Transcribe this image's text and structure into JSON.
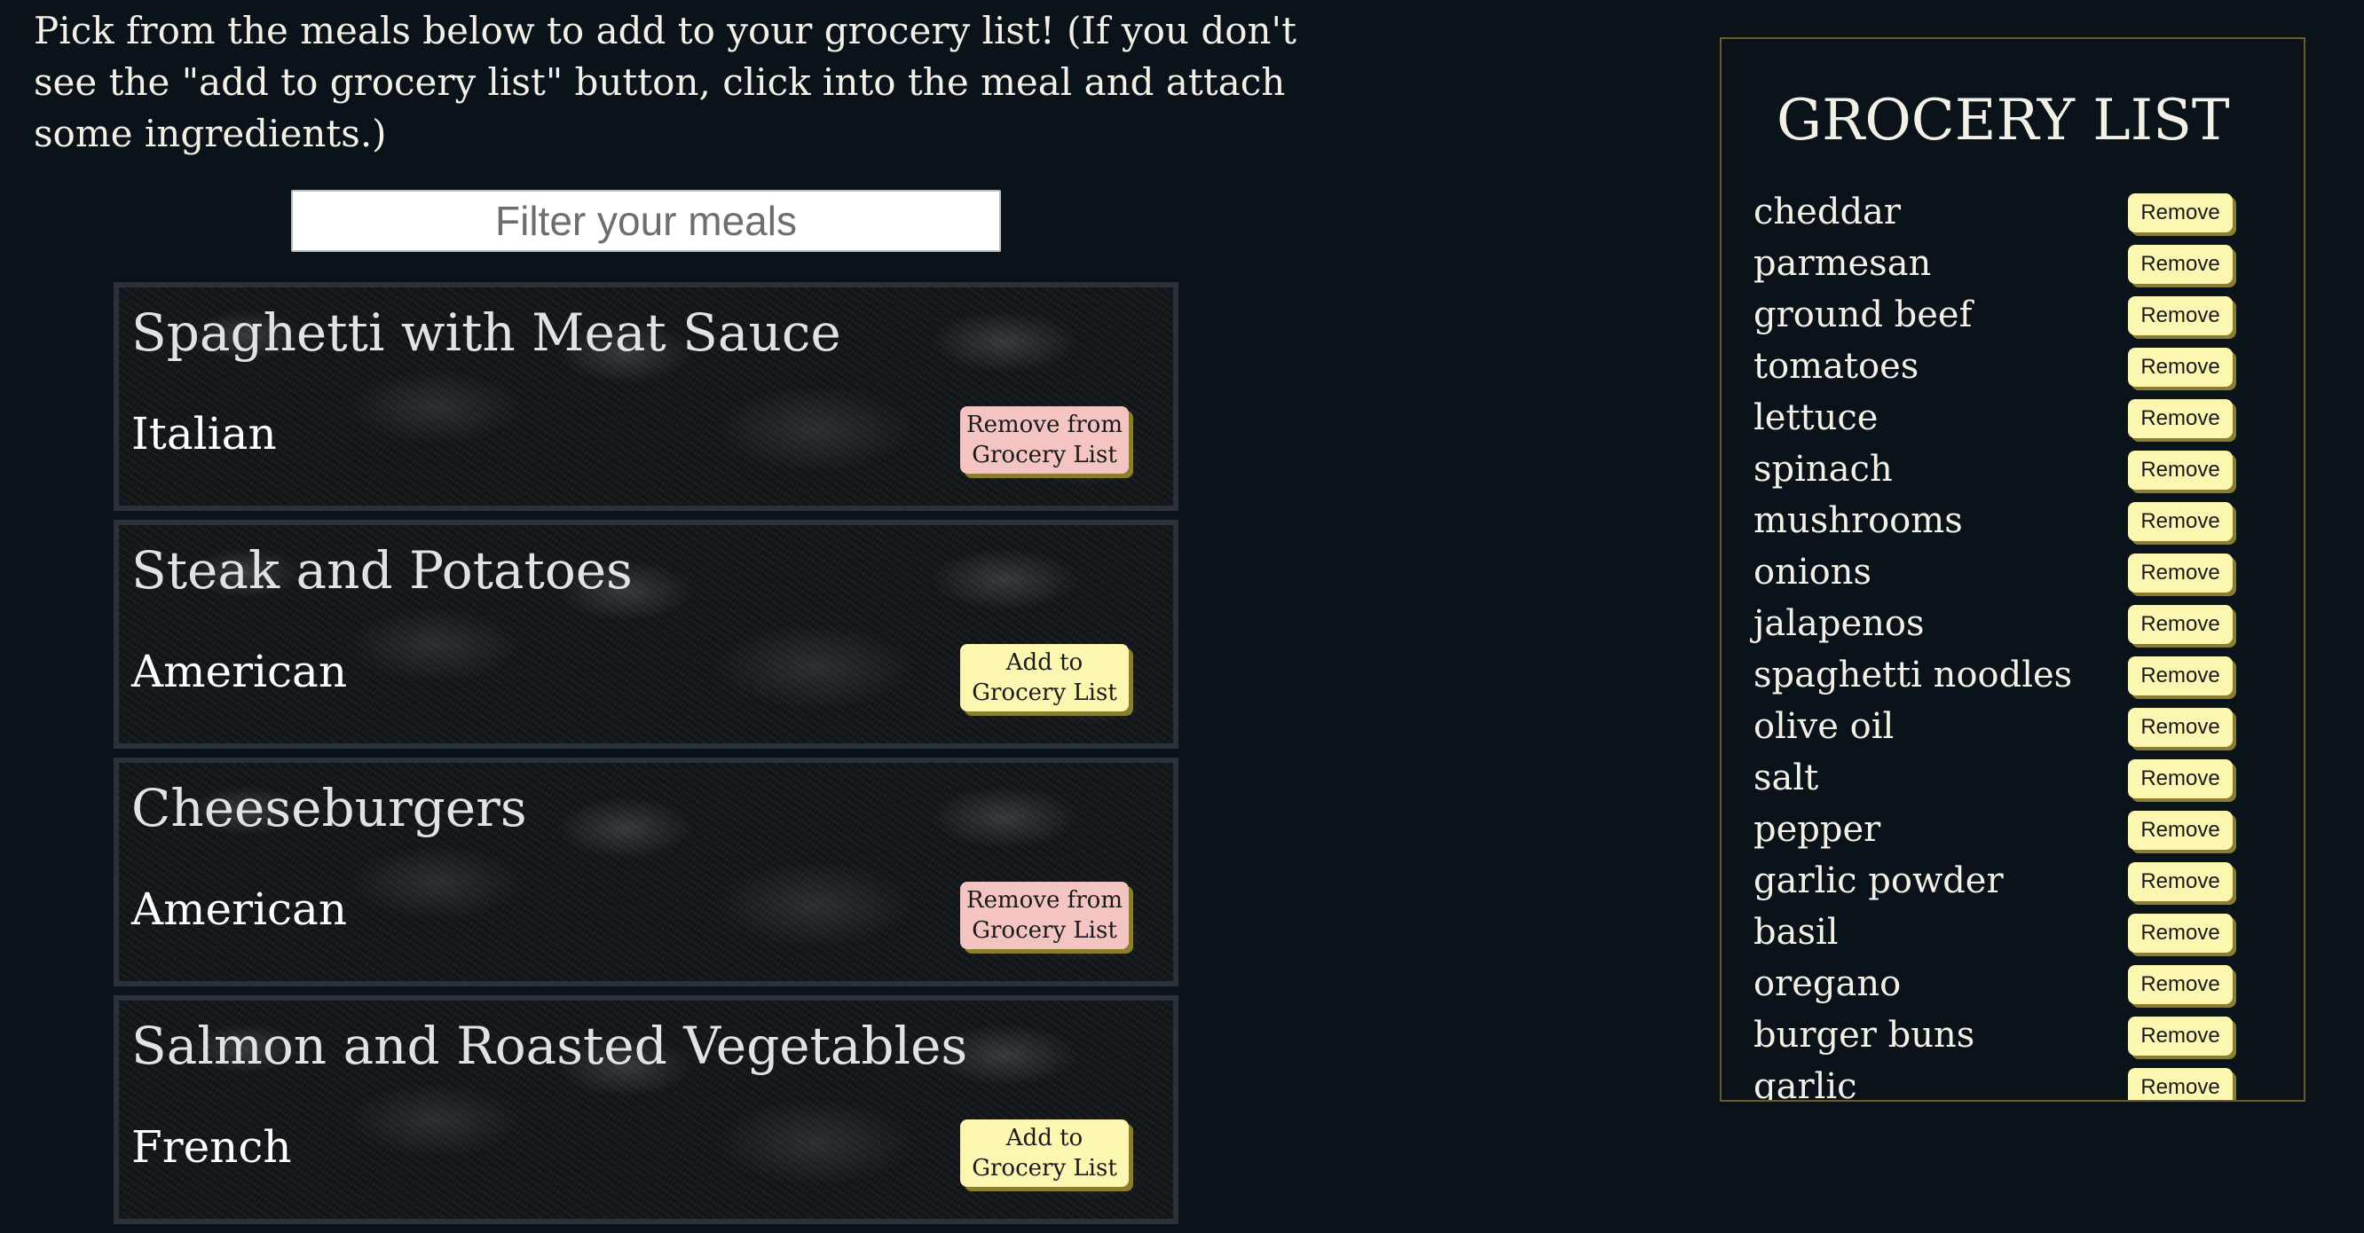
{
  "intro_text": "Pick from the meals below to add to your grocery list! (If you don't see the \"add to grocery list\" button, click into the meal and attach some ingredients.)",
  "filter": {
    "placeholder": "Filter your meals",
    "value": ""
  },
  "meals": [
    {
      "name": "Spaghetti with Meat Sauce",
      "cuisine": "Italian",
      "button_label": "Remove from Grocery List",
      "in_list": true
    },
    {
      "name": "Steak and Potatoes",
      "cuisine": "American",
      "button_label": "Add to Grocery List",
      "in_list": false
    },
    {
      "name": "Cheeseburgers",
      "cuisine": "American",
      "button_label": "Remove from Grocery List",
      "in_list": true
    },
    {
      "name": "Salmon and Roasted Vegetables",
      "cuisine": "French",
      "button_label": "Add to Grocery List",
      "in_list": false
    }
  ],
  "grocery_list": {
    "title": "GROCERY LIST",
    "remove_label": "Remove",
    "items": [
      "cheddar",
      "parmesan",
      "ground beef",
      "tomatoes",
      "lettuce",
      "spinach",
      "mushrooms",
      "onions",
      "jalapenos",
      "spaghetti noodles",
      "olive oil",
      "salt",
      "pepper",
      "garlic powder",
      "basil",
      "oregano",
      "burger buns",
      "garlic"
    ]
  },
  "colors": {
    "background": "#0a1319",
    "add_button": "#fbf6b0",
    "remove_from_list_button": "#f3c4c2",
    "panel_border": "#6b5d2a"
  }
}
